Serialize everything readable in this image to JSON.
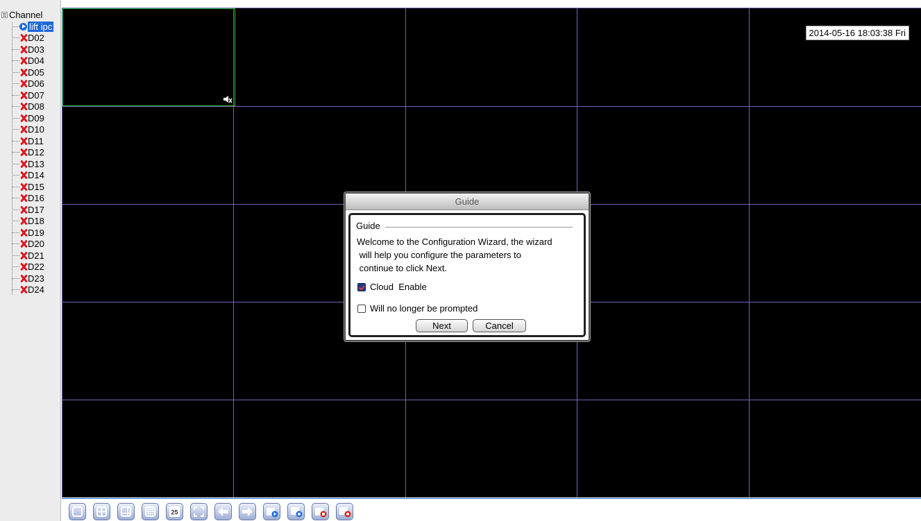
{
  "sidebar": {
    "root_label": "Channel",
    "active_channel": "lift ipc",
    "channels": [
      "D02",
      "D03",
      "D04",
      "D05",
      "D06",
      "D07",
      "D08",
      "D09",
      "D10",
      "D11",
      "D12",
      "D13",
      "D14",
      "D15",
      "D16",
      "D17",
      "D18",
      "D19",
      "D20",
      "D21",
      "D22",
      "D23",
      "D24"
    ]
  },
  "video": {
    "timestamp": "2014-05-16 18:03:38 Fri",
    "grid_rows": 5,
    "grid_cols": 5,
    "selected_border_color": "#27c43b",
    "grid_line_color": "#7a63b0"
  },
  "dialog": {
    "title": "Guide",
    "group_title": "Guide",
    "welcome_lines": [
      "Welcome to the Configuration Wizard, the wizard",
      " will help you configure the parameters to",
      " continue to click Next."
    ],
    "cloud_label": "Cloud  Enable",
    "cloud_checked": true,
    "prompt_label": "Will no longer be prompted",
    "prompt_checked": false,
    "next_label": "Next",
    "cancel_label": "Cancel"
  },
  "toolbar": {
    "icons": [
      "single-view-icon",
      "quad-view-icon",
      "split-9-view-icon",
      "split-16-view-icon",
      "split-25-view-icon",
      "fullscreen-icon",
      "previous-icon",
      "next-icon",
      "start-preview-icon",
      "start-all-preview-icon",
      "stop-record-icon",
      "stop-all-record-icon"
    ],
    "split_25_label": "25"
  },
  "colors": {
    "accent": "#1e6ad6",
    "error_x": "#e0141e"
  }
}
